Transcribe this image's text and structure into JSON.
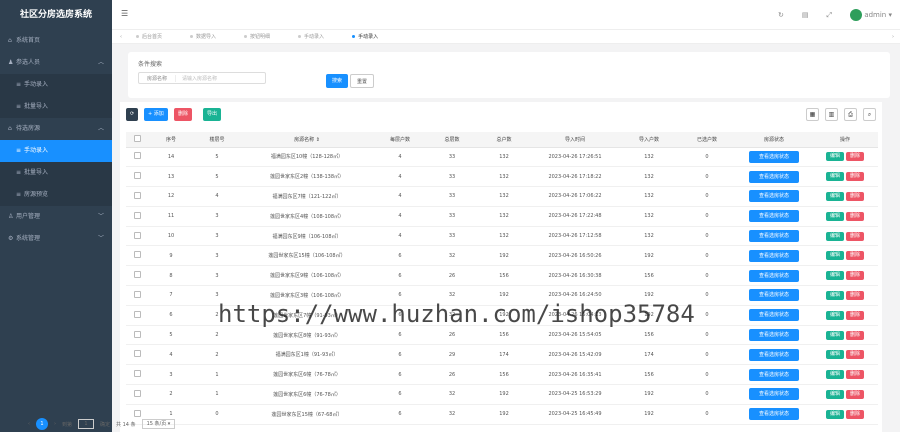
{
  "app": {
    "title": "社区分房选房系统"
  },
  "sidebar": {
    "items": [
      {
        "icon": "home-icon",
        "label": "系统首页"
      },
      {
        "icon": "user-icon",
        "label": "参选人员"
      },
      {
        "label": "手动录入"
      },
      {
        "label": "批量导入"
      },
      {
        "icon": "house-icon",
        "label": "待选房源"
      },
      {
        "label": "手动录入"
      },
      {
        "label": "批量导入"
      },
      {
        "label": "房源预览"
      },
      {
        "icon": "users-icon",
        "label": "用户管理"
      },
      {
        "icon": "gear-icon",
        "label": "系统管理"
      }
    ]
  },
  "topbar": {
    "user": "admin"
  },
  "tabs": [
    "后台首页",
    "数据导入",
    "按钮明细",
    "手动录入",
    "手动录入"
  ],
  "search": {
    "legend": "条件搜索",
    "field_label": "房源名称",
    "placeholder": "请输入房源名称",
    "search_label": "搜索",
    "reset_label": "重置"
  },
  "toolbar": {
    "add_label": "+ 添加",
    "delete_label": "删除",
    "export_label": "导出"
  },
  "table": {
    "headers": [
      "序号",
      "楼层号",
      "房源名称 ⇕",
      "每层户数",
      "总层数",
      "总户数",
      "导入时间",
      "导入户数",
      "已选户数",
      "房源状态",
      "操作"
    ],
    "status_label": "查看选房状态",
    "edit_label": "编辑",
    "del_label": "删除",
    "rows": [
      [
        "14",
        "5",
        "福满园东区10幢（128-128㎡）",
        "4",
        "33",
        "132",
        "2023-04-26 17:26:51",
        "132",
        "0"
      ],
      [
        "13",
        "5",
        "莲园世家东区2幢（138-138㎡）",
        "4",
        "33",
        "132",
        "2023-04-26 17:18:22",
        "132",
        "0"
      ],
      [
        "12",
        "4",
        "福满园东区7幢（121-122㎡）",
        "4",
        "33",
        "132",
        "2023-04-26 17:06:22",
        "132",
        "0"
      ],
      [
        "11",
        "3",
        "莲园世家东区4幢（108-108㎡）",
        "4",
        "33",
        "132",
        "2023-04-26 17:22:48",
        "132",
        "0"
      ],
      [
        "10",
        "3",
        "福满园东区9幢（106-108㎡）",
        "4",
        "33",
        "132",
        "2023-04-26 17:12:58",
        "132",
        "0"
      ],
      [
        "9",
        "3",
        "莲园世家东区15幢（106-108㎡）",
        "6",
        "32",
        "192",
        "2023-04-26 16:50:26",
        "192",
        "0"
      ],
      [
        "8",
        "3",
        "莲园世家东区9幢（106-108㎡）",
        "6",
        "26",
        "156",
        "2023-04-26 16:30:38",
        "156",
        "0"
      ],
      [
        "7",
        "3",
        "莲园世家东区3幢（106-108㎡）",
        "6",
        "32",
        "192",
        "2023-04-26 16:24:50",
        "192",
        "0"
      ],
      [
        "6",
        "2",
        "莲园世家东区7幢（91-93㎡）",
        "6",
        "32",
        "192",
        "2023-04-26 16:04:13",
        "192",
        "0"
      ],
      [
        "5",
        "2",
        "莲园世家东区8幢（91-93㎡）",
        "6",
        "26",
        "156",
        "2023-04-26 15:54:05",
        "156",
        "0"
      ],
      [
        "4",
        "2",
        "福满园东区1幢（91-93㎡）",
        "6",
        "29",
        "174",
        "2023-04-26 15:42:09",
        "174",
        "0"
      ],
      [
        "3",
        "1",
        "莲园世家东区6幢（76-78㎡）",
        "6",
        "26",
        "156",
        "2023-04-26 16:35:41",
        "156",
        "0"
      ],
      [
        "2",
        "1",
        "莲园世家东区6幢（76-78㎡）",
        "6",
        "32",
        "192",
        "2023-04-25 16:53:29",
        "192",
        "0"
      ],
      [
        "1",
        "0",
        "莲园世家东区15幢（67-68㎡）",
        "6",
        "32",
        "192",
        "2023-04-25 16:45:49",
        "192",
        "0"
      ]
    ]
  },
  "pager": {
    "page": "1",
    "goto": "到第",
    "page_input": "1",
    "confirm": "确定",
    "total": "共 14 条",
    "per_page": "15 条/页"
  },
  "watermark": "https://www.huzhan.com/ishop35784"
}
